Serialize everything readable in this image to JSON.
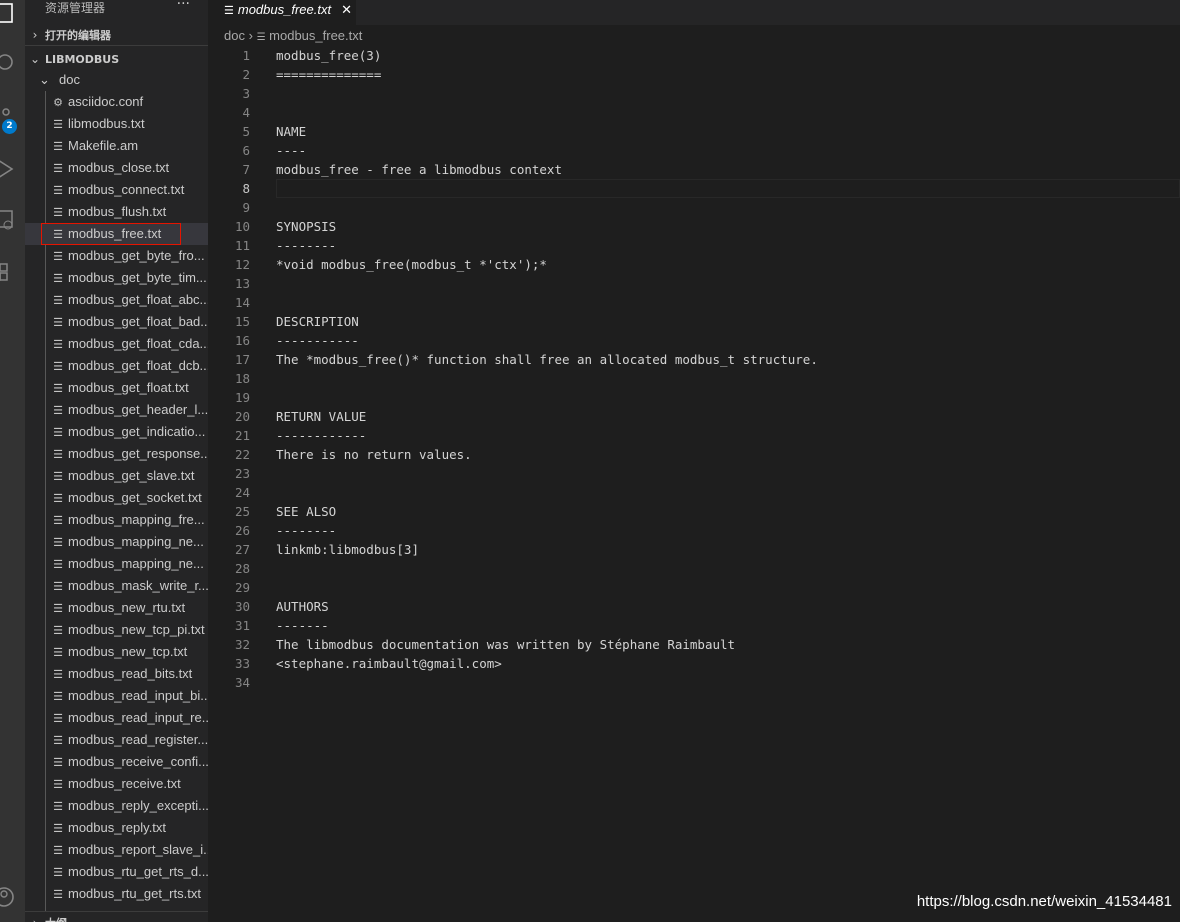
{
  "activity": {
    "badge": "2",
    "icons": [
      "files-icon",
      "search-icon",
      "source-control-icon",
      "run-debug-icon",
      "remote-icon",
      "extensions-icon",
      "account-icon"
    ]
  },
  "sidebar": {
    "title": "资源管理器",
    "more": "···",
    "open_editors": "打开的编辑器",
    "project": "LIBMODBUS",
    "folder": "doc",
    "outline": "大纲",
    "files": [
      "asciidoc.conf",
      "libmodbus.txt",
      "Makefile.am",
      "modbus_close.txt",
      "modbus_connect.txt",
      "modbus_flush.txt",
      "modbus_free.txt",
      "modbus_get_byte_fro...",
      "modbus_get_byte_tim...",
      "modbus_get_float_abc...",
      "modbus_get_float_bad...",
      "modbus_get_float_cda...",
      "modbus_get_float_dcb...",
      "modbus_get_float.txt",
      "modbus_get_header_l...",
      "modbus_get_indicatio...",
      "modbus_get_response...",
      "modbus_get_slave.txt",
      "modbus_get_socket.txt",
      "modbus_mapping_fre...",
      "modbus_mapping_ne...",
      "modbus_mapping_ne...",
      "modbus_mask_write_r...",
      "modbus_new_rtu.txt",
      "modbus_new_tcp_pi.txt",
      "modbus_new_tcp.txt",
      "modbus_read_bits.txt",
      "modbus_read_input_bi...",
      "modbus_read_input_re...",
      "modbus_read_register...",
      "modbus_receive_confi...",
      "modbus_receive.txt",
      "modbus_reply_excepti...",
      "modbus_reply.txt",
      "modbus_report_slave_i...",
      "modbus_rtu_get_rts_d...",
      "modbus_rtu_get_rts.txt"
    ],
    "selected": "modbus_free.txt"
  },
  "tab": {
    "label": "modbus_free.txt",
    "close": "✕"
  },
  "breadcrumb": {
    "folder": "doc",
    "sep": "›",
    "file": "modbus_free.txt"
  },
  "editor": {
    "current_line": 8,
    "lines": [
      "modbus_free(3)",
      "==============",
      "",
      "",
      "NAME",
      "----",
      "modbus_free - free a libmodbus context",
      "",
      "",
      "SYNOPSIS",
      "--------",
      "*void modbus_free(modbus_t *'ctx');*",
      "",
      "",
      "DESCRIPTION",
      "-----------",
      "The *modbus_free()* function shall free an allocated modbus_t structure.",
      "",
      "",
      "RETURN VALUE",
      "------------",
      "There is no return values.",
      "",
      "",
      "SEE ALSO",
      "--------",
      "linkmb:libmodbus[3]",
      "",
      "",
      "AUTHORS",
      "-------",
      "The libmodbus documentation was written by Stéphane Raimbault",
      "<stephane.raimbault@gmail.com>",
      ""
    ]
  },
  "watermark": "https://blog.csdn.net/weixin_41534481"
}
